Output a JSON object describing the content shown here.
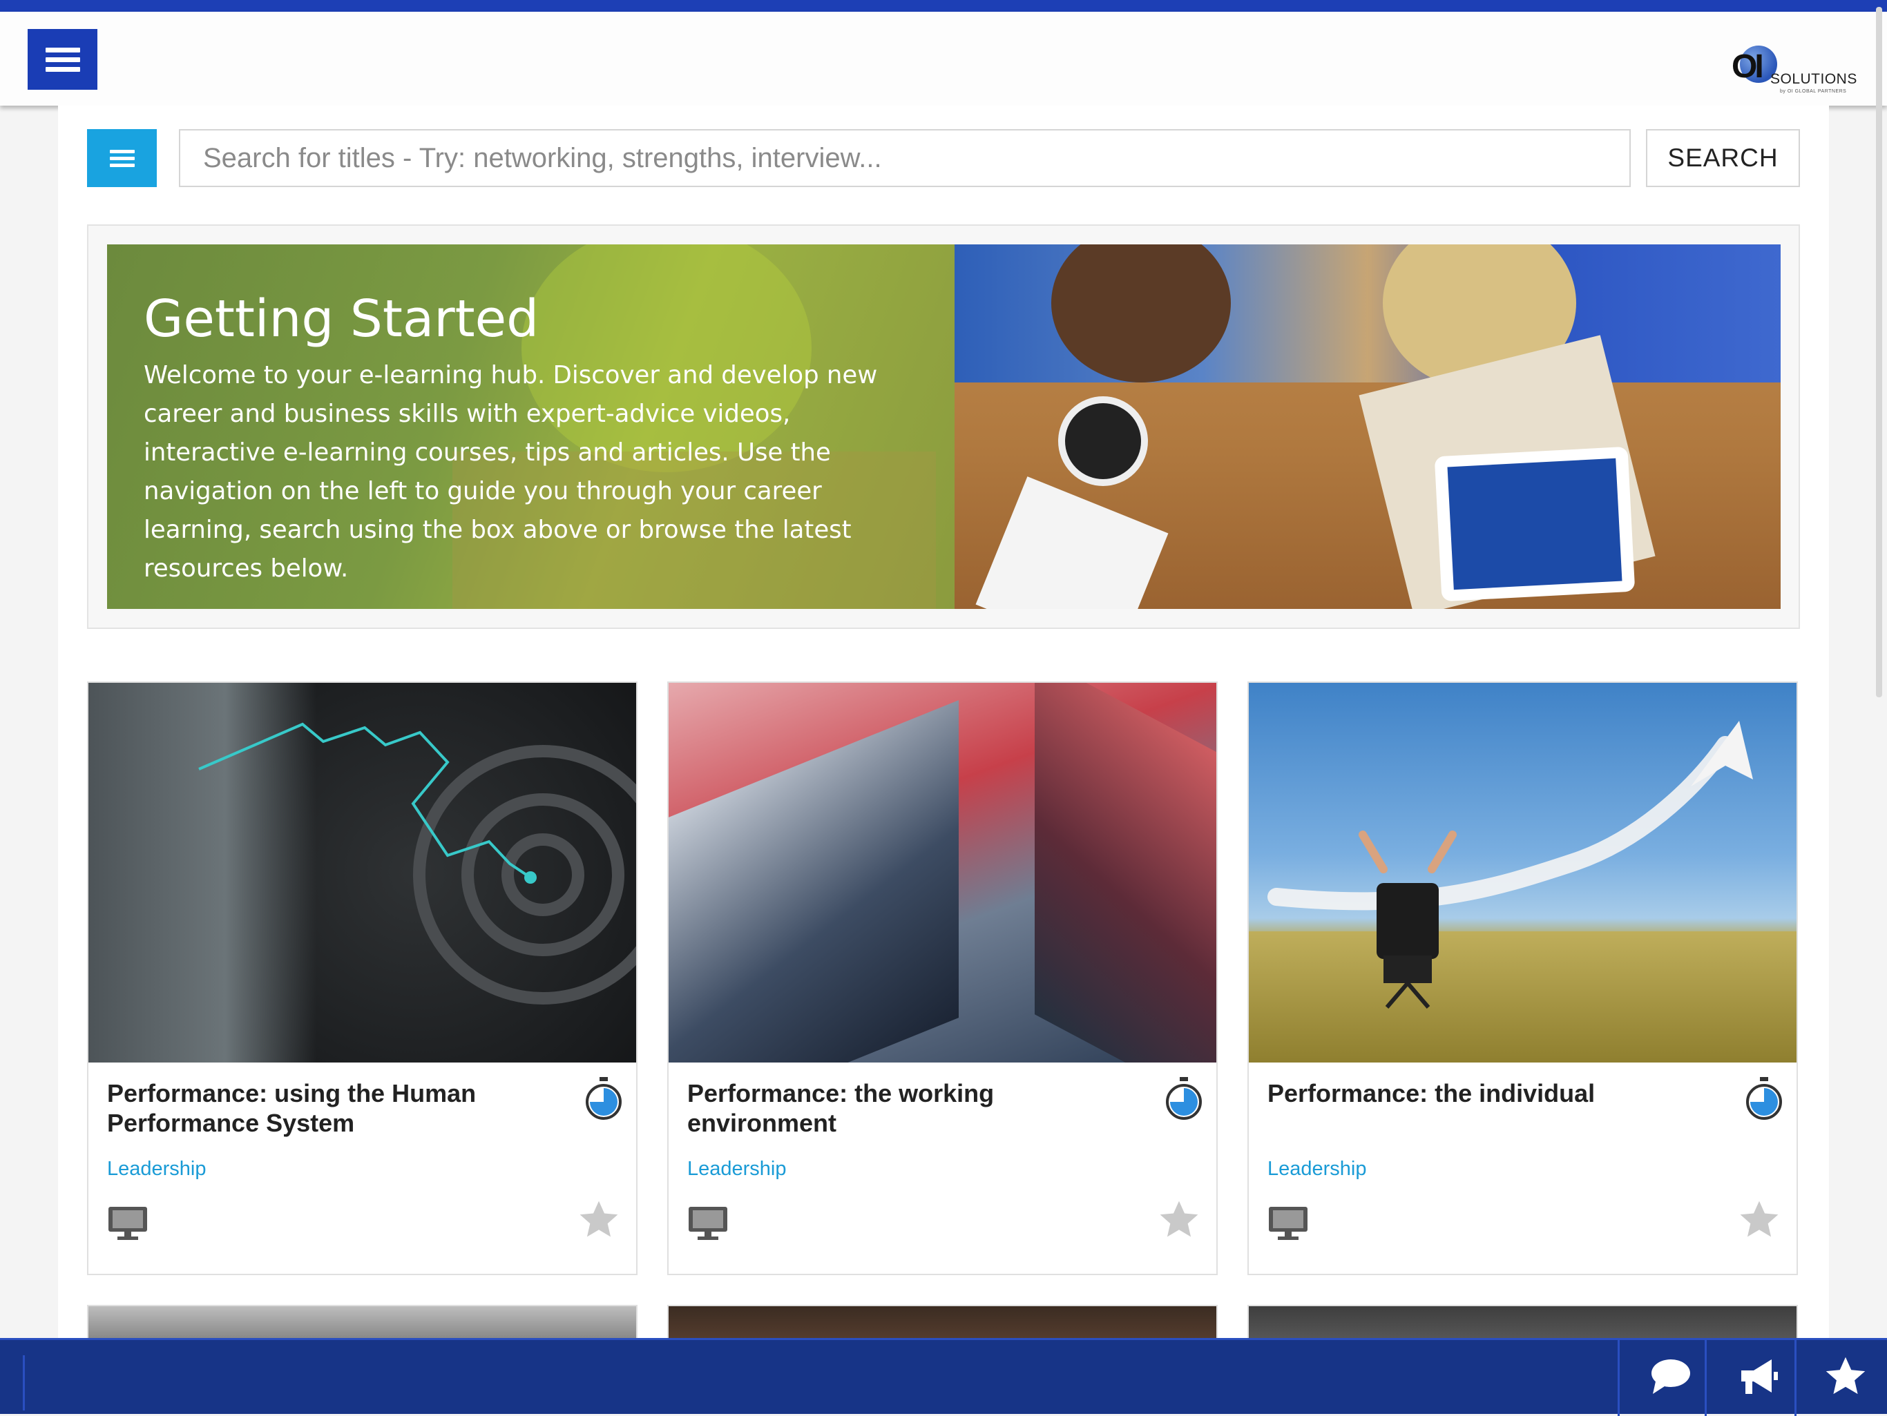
{
  "header": {
    "logo_mark": "OI",
    "logo_text": "SOLUTIONS",
    "logo_tagline": "by OI GLOBAL PARTNERS"
  },
  "search": {
    "placeholder": "Search for titles - Try: networking, strengths, interview...",
    "button_label": "SEARCH"
  },
  "hero": {
    "title": "Getting Started",
    "body": "Welcome to your e-learning hub. Discover and develop new career and business skills with expert-advice videos, interactive e-learning courses, tips and articles. Use the navigation on the left to guide you through your career learning, search using the box above or browse the latest resources below."
  },
  "cards": [
    {
      "title": "Performance: using the Human Performance System",
      "category": "Leadership",
      "image": "maze-image",
      "icons": [
        "timer-icon",
        "monitor-icon",
        "star-icon"
      ]
    },
    {
      "title": "Performance: the working environment",
      "category": "Leadership",
      "image": "skyscrapers-image",
      "icons": [
        "timer-icon",
        "monitor-icon",
        "star-icon"
      ]
    },
    {
      "title": "Performance: the individual",
      "category": "Leadership",
      "image": "field-arrow-image",
      "icons": [
        "timer-icon",
        "monitor-icon",
        "star-icon"
      ]
    }
  ],
  "bottom_bar": {
    "icons": [
      "chat-icon",
      "megaphone-icon",
      "star-icon"
    ]
  },
  "colors": {
    "brand_blue": "#1a3db5",
    "accent_cyan": "#19a3e0",
    "link_blue": "#1a9bd6",
    "bottom_bar": "#173487"
  }
}
